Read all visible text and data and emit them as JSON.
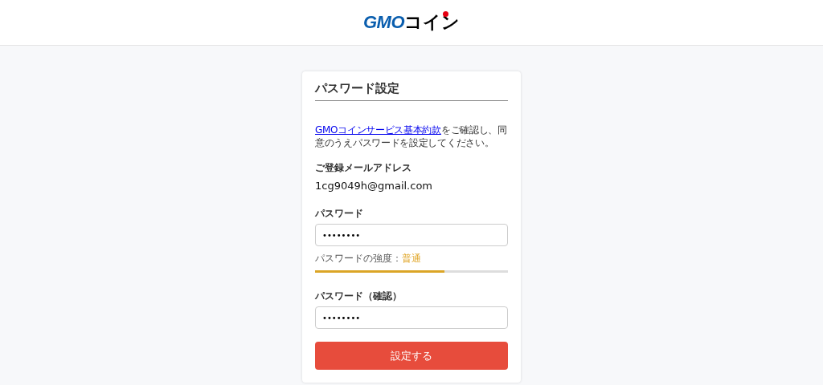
{
  "logo": {
    "primary": "GMO",
    "secondary": "コイン"
  },
  "card": {
    "title": "パスワード設定",
    "intro": {
      "link": "GMOコインサービス基本約款",
      "text": "をご確認し、同意のうえパスワードを設定してください。"
    },
    "email": {
      "label": "ご登録メールアドレス",
      "value": "1cg9049h@gmail.com"
    },
    "password": {
      "label": "パスワード",
      "value": "••••••••"
    },
    "strength": {
      "label": "パスワードの強度：",
      "value": "普通",
      "level": 0.67
    },
    "confirm": {
      "label": "パスワード（確認）",
      "value": "••••••••"
    },
    "submit": "設定する"
  }
}
